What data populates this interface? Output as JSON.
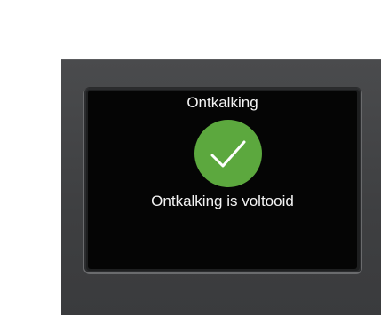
{
  "screen": {
    "title": "Ontkalking",
    "status_icon": "checkmark-icon",
    "message": "Ontkalking is voltooid"
  },
  "colors": {
    "panel": "#3f4042",
    "screen_background": "#050505",
    "success": "#5ca83e",
    "text": "#ffffff"
  }
}
